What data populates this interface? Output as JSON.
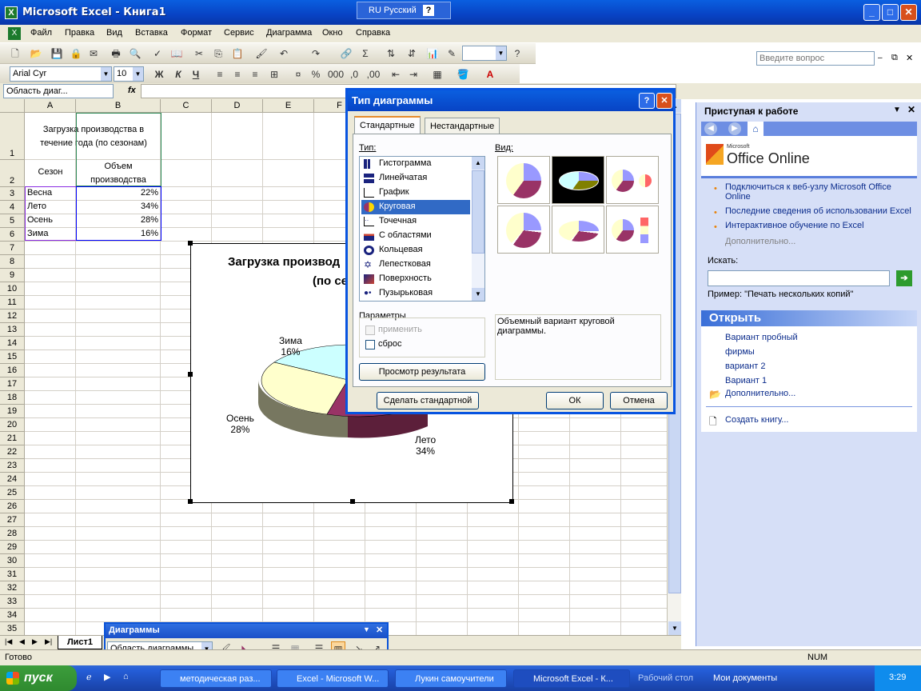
{
  "window": {
    "title": "Microsoft Excel - Книга1",
    "lang": "RU Русский"
  },
  "menu": [
    "Файл",
    "Правка",
    "Вид",
    "Вставка",
    "Формат",
    "Сервис",
    "Диаграмма",
    "Окно",
    "Справка"
  ],
  "help_placeholder": "Введите вопрос",
  "font": {
    "name": "Arial Cyr",
    "size": "10"
  },
  "format_buttons": [
    "Ж",
    "К",
    "Ч"
  ],
  "namebox": "Область диаг...",
  "fx": "fx",
  "columns": [
    "A",
    "B",
    "C",
    "D",
    "E",
    "F"
  ],
  "rows": [
    "1",
    "2",
    "3",
    "4",
    "5",
    "6",
    "7",
    "8",
    "9",
    "10",
    "11",
    "12",
    "13",
    "14",
    "15",
    "16",
    "17",
    "18",
    "19",
    "20",
    "21",
    "22",
    "23",
    "24",
    "25",
    "26",
    "27",
    "28",
    "29",
    "30",
    "31",
    "32",
    "33",
    "34",
    "35"
  ],
  "sheet": {
    "b1": "Загрузка производства в течение года (по сезонам)",
    "a2": "Сезон",
    "b2": "Объем производства",
    "table": [
      {
        "season": "Весна",
        "value": "22%"
      },
      {
        "season": "Лето",
        "value": "34%"
      },
      {
        "season": "Осень",
        "value": "28%"
      },
      {
        "season": "Зима",
        "value": "16%"
      }
    ]
  },
  "chart_data": {
    "type": "pie",
    "title_line1": "Загрузка производ",
    "title_line2": "(по се",
    "labels": [
      {
        "name": "Зима",
        "pct": "16%",
        "color": "#ccffff"
      },
      {
        "name": "Осень",
        "pct": "28%",
        "color": "#ffffcc"
      },
      {
        "name": "Лето",
        "pct": "34%",
        "color": "#993366"
      }
    ]
  },
  "dialog": {
    "title": "Тип диаграммы",
    "tab_standard": "Стандартные",
    "tab_custom": "Нестандартные",
    "type_label": "Тип:",
    "view_label": "Вид:",
    "types": [
      "Гистограмма",
      "Линейчатая",
      "График",
      "Круговая",
      "Точечная",
      "С областями",
      "Кольцевая",
      "Лепестковая",
      "Поверхность",
      "Пузырьковая"
    ],
    "params_label": "Параметры",
    "apply_label": "применить",
    "reset_label": "сброс",
    "preview_button": "Просмотр результата",
    "description": "Объемный вариант круговой диаграммы.",
    "make_default": "Сделать стандартной",
    "ok": "ОК",
    "cancel": "Отмена"
  },
  "taskpane": {
    "title": "Приступая к работе",
    "office_online": "Office Online",
    "office_small": "Microsoft",
    "links": [
      "Подключиться к веб-узлу Microsoft Office Online",
      "Последние сведения об использовании Excel",
      "Интерактивное обучение по Excel"
    ],
    "more": "Дополнительно...",
    "search_label": "Искать:",
    "example": "Пример:  \"Печать нескольких копий\"",
    "open_title": "Открыть",
    "files": [
      "Вариант пробный",
      "фирмы",
      "вариант 2",
      "Вариант 1"
    ],
    "open_more": "Дополнительно...",
    "create": "Создать книгу..."
  },
  "sheet_tab": "Лист1",
  "status": {
    "ready": "Готово",
    "num": "NUM"
  },
  "chart_toolbar": {
    "title": "Диаграммы",
    "select": "Область диаграммы"
  },
  "taskbar": {
    "start": "пуск",
    "items": [
      "методическая раз...",
      "Excel - Microsoft W...",
      "Лукин самоучители",
      "Microsoft Excel - К..."
    ],
    "desktop": "Рабочий стол",
    "docs": "Мои документы",
    "time": "3:29"
  }
}
